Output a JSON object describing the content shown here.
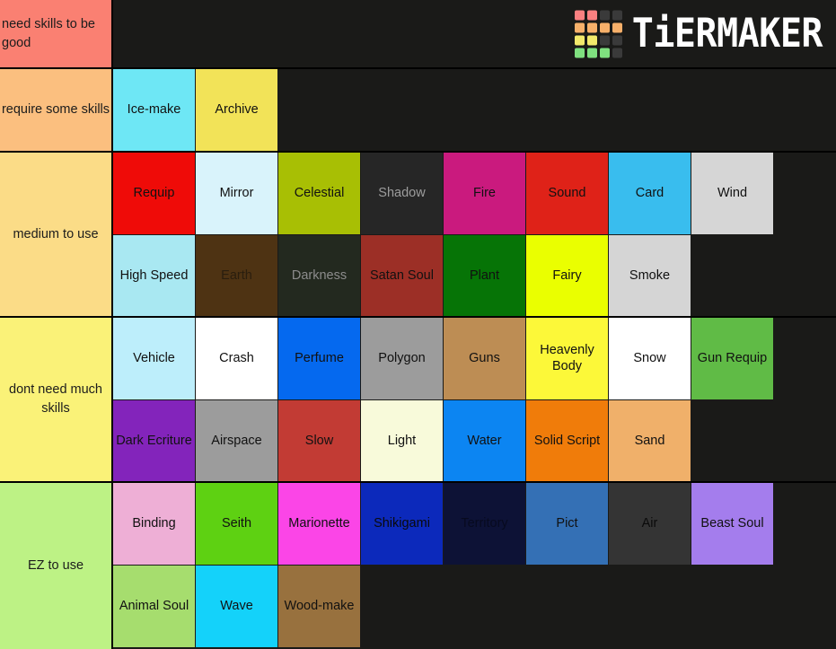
{
  "app": {
    "brand": "TiERMAKER",
    "background_color": "#1a1a18",
    "logo_colors": [
      "#f98080",
      "#f98080",
      "#3a3a3a",
      "#3a3a3a",
      "#f7b06a",
      "#f7b06a",
      "#f7b06a",
      "#f7b06a",
      "#f2e96b",
      "#f2e96b",
      "#3a3a3a",
      "#3a3a3a",
      "#7fe07f",
      "#7fe07f",
      "#7fe07f",
      "#3a3a3a"
    ]
  },
  "tiers": [
    {
      "label": "need skills to be good",
      "label_color": "#fa8072",
      "align": "left",
      "items": []
    },
    {
      "label": "require some skills",
      "label_color": "#fbbf7f",
      "align": "center",
      "items": [
        {
          "name": "Ice-make",
          "color": "#6ee7f5"
        },
        {
          "name": "Archive",
          "color": "#f2e358"
        }
      ]
    },
    {
      "label": "medium to use",
      "label_color": "#fbdc87",
      "align": "center",
      "items": [
        {
          "name": "Requip",
          "color": "#ef0b08"
        },
        {
          "name": "Mirror",
          "color": "#d9f3fb"
        },
        {
          "name": "Celestial",
          "color": "#a8bf04"
        },
        {
          "name": "Shadow",
          "color": "#262626",
          "text_color": "#9d9d9d"
        },
        {
          "name": "Fire",
          "color": "#ca1a7e"
        },
        {
          "name": "Sound",
          "color": "#df2218"
        },
        {
          "name": "Card",
          "color": "#39bdee"
        },
        {
          "name": "Wind",
          "color": "#d6d6d6"
        },
        {
          "name": "High Speed",
          "color": "#a9e8f2"
        },
        {
          "name": "Earth",
          "color": "#4e3313",
          "text_color": "#2a1e0e"
        },
        {
          "name": "Darkness",
          "color": "#23291f",
          "text_color": "#8c8c8c"
        },
        {
          "name": "Satan Soul",
          "color": "#9c2f26"
        },
        {
          "name": "Plant",
          "color": "#067406"
        },
        {
          "name": "Fairy",
          "color": "#eaff00"
        },
        {
          "name": "Smoke",
          "color": "#d5d5d5"
        }
      ]
    },
    {
      "label": "dont need much skills",
      "label_color": "#faf278",
      "align": "center",
      "items": [
        {
          "name": "Vehicle",
          "color": "#bdeefb"
        },
        {
          "name": "Crash",
          "color": "#ffffff"
        },
        {
          "name": "Perfume",
          "color": "#0569ef"
        },
        {
          "name": "Polygon",
          "color": "#9c9c9c"
        },
        {
          "name": "Guns",
          "color": "#bd8d54"
        },
        {
          "name": "Heavenly Body",
          "color": "#fcf839"
        },
        {
          "name": "Snow",
          "color": "#ffffff"
        },
        {
          "name": "Gun Requip",
          "color": "#60bb46"
        },
        {
          "name": "Dark Ecriture",
          "color": "#8324bb"
        },
        {
          "name": "Airspace",
          "color": "#9c9c9c"
        },
        {
          "name": "Slow",
          "color": "#c23b34"
        },
        {
          "name": "Light",
          "color": "#f8fada"
        },
        {
          "name": "Water",
          "color": "#0c85f2"
        },
        {
          "name": "Solid Script",
          "color": "#f07c0a"
        },
        {
          "name": "Sand",
          "color": "#f0b06a"
        }
      ]
    },
    {
      "label": "EZ to use",
      "label_color": "#bdf285",
      "align": "center",
      "items": [
        {
          "name": "Binding",
          "color": "#eeafd6"
        },
        {
          "name": "Seith",
          "color": "#5ed112"
        },
        {
          "name": "Marionette",
          "color": "#fb45e7"
        },
        {
          "name": "Shikigami",
          "color": "#0c29bb",
          "text_color": "#0a0a0a"
        },
        {
          "name": "Territory",
          "color": "#0d1236",
          "text_color": "#070a1f"
        },
        {
          "name": "Pict",
          "color": "#3470b5"
        },
        {
          "name": "Air",
          "color": "#343434",
          "text_color": "#0a0a0a"
        },
        {
          "name": "Beast Soul",
          "color": "#a47ded"
        },
        {
          "name": "Animal Soul",
          "color": "#a6dd6e"
        },
        {
          "name": "Wave",
          "color": "#14d2fa"
        },
        {
          "name": "Wood-make",
          "color": "#98713e"
        }
      ]
    }
  ]
}
